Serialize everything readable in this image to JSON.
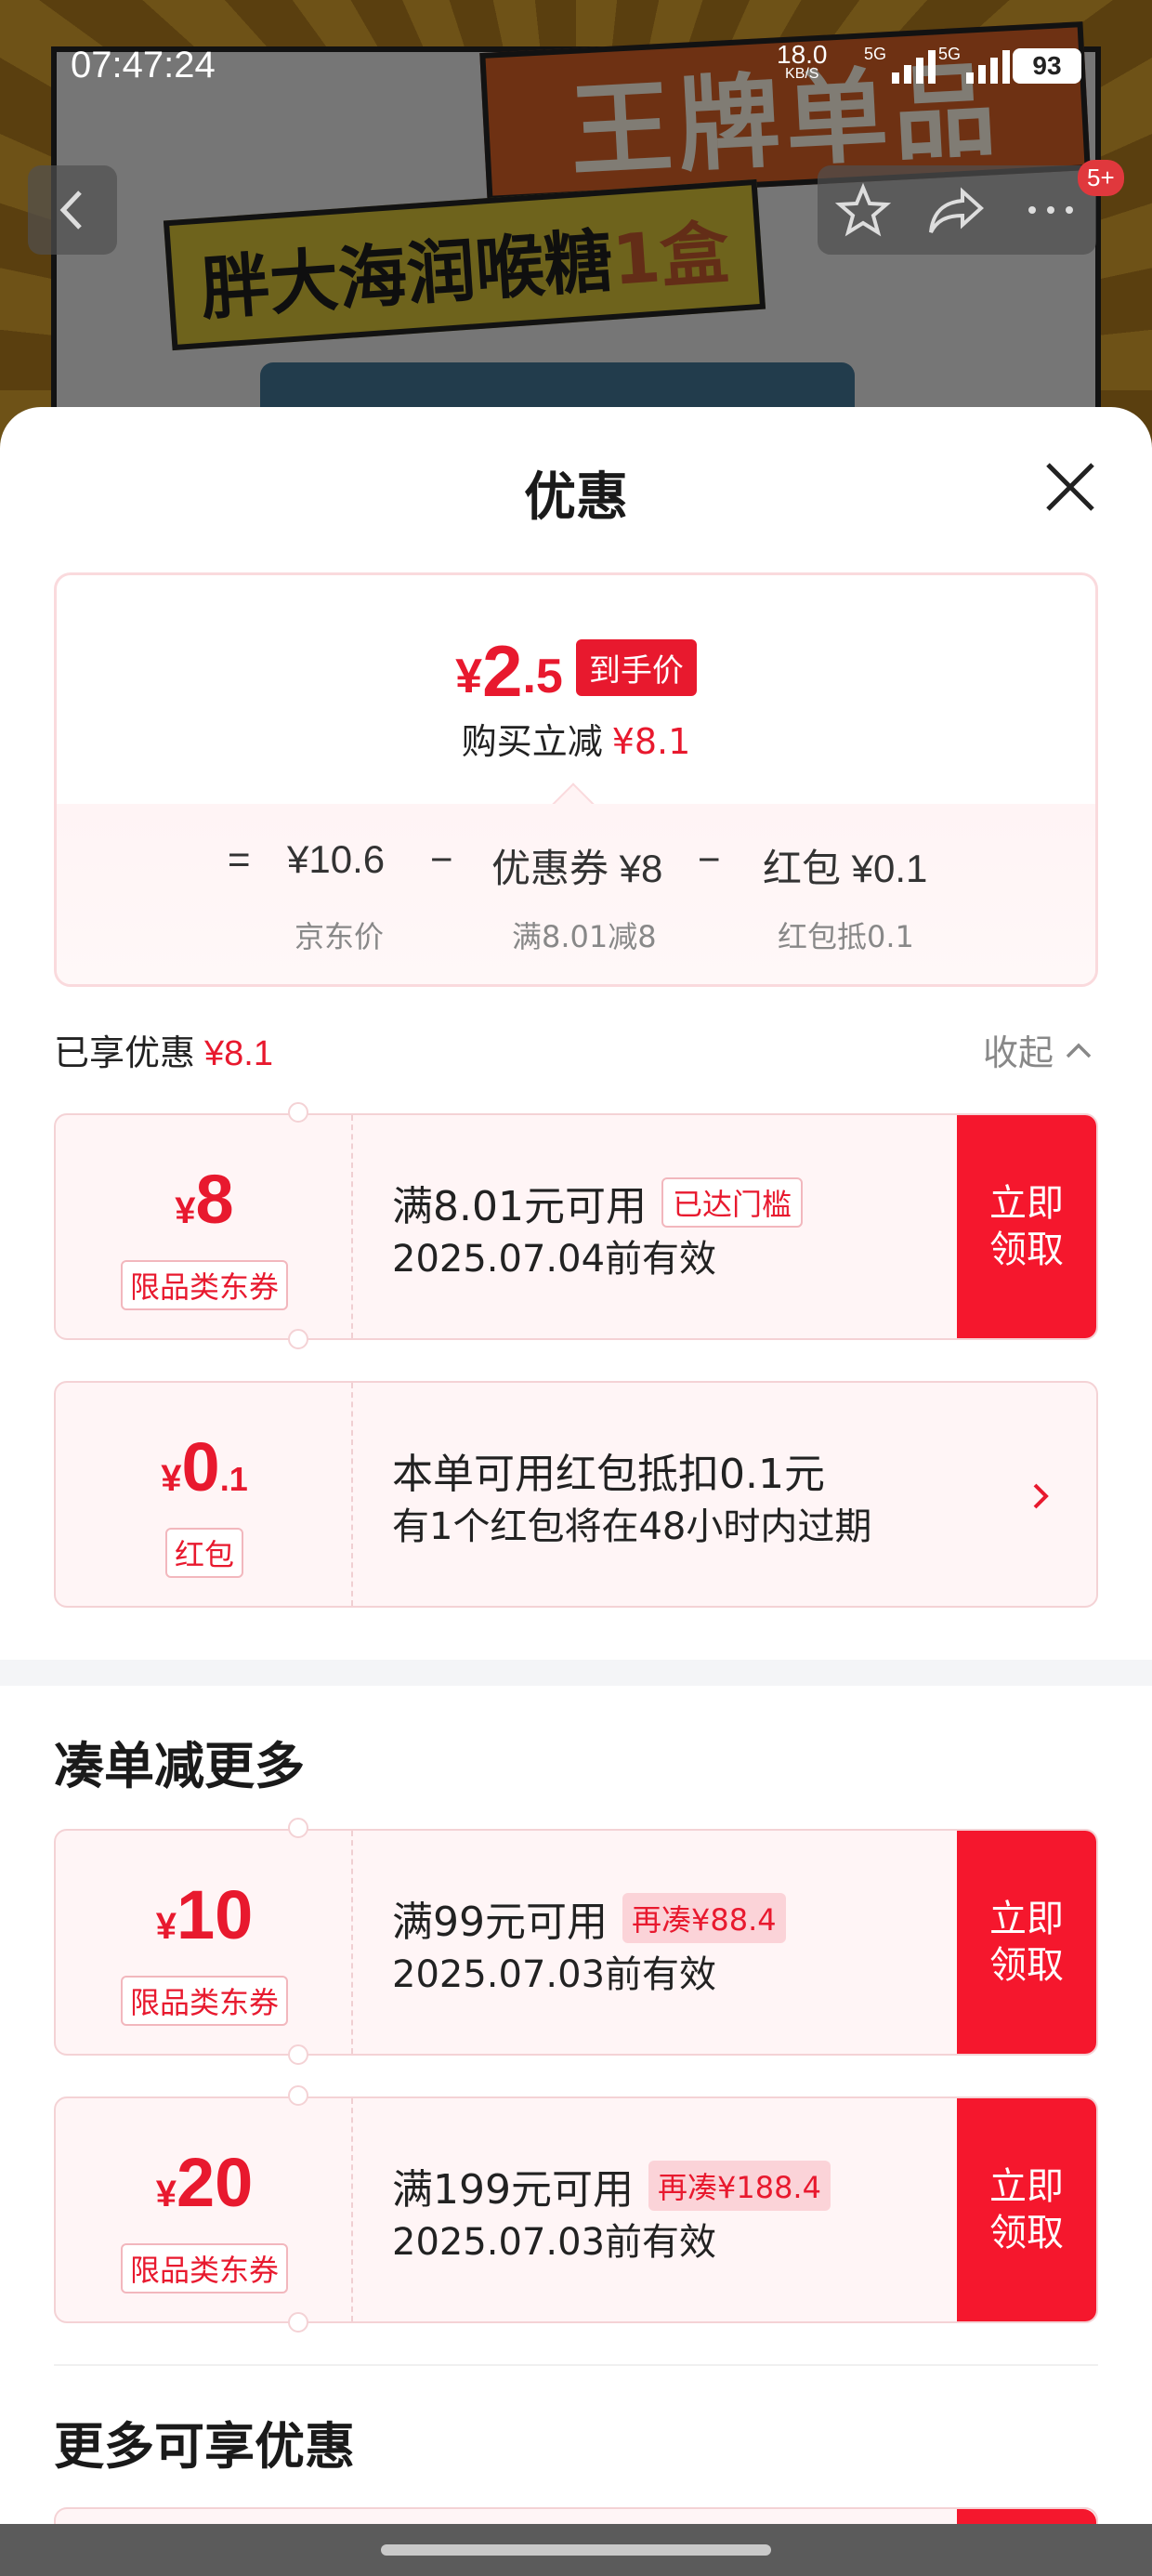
{
  "background": {
    "banner_top": "王牌单品",
    "banner_mid_text": "胖大海润喉糖",
    "banner_mid_qty": "1盒"
  },
  "status_bar": {
    "time": "07:47:24",
    "net_speed": "18.0",
    "net_unit": "KB/S",
    "sim1": "5G",
    "sim2": "5G",
    "battery": "93"
  },
  "nav": {
    "badge": "5+"
  },
  "sheet": {
    "title": "优惠",
    "summary": {
      "currency": "¥",
      "price_int": "2",
      "price_dec": ".5",
      "price_tag": "到手价",
      "save_label": "购买立减",
      "save_amount": "¥8.1",
      "eq": "=",
      "jd_price": "¥10.6",
      "minus1": "−",
      "coupon_part": "优惠券 ¥8",
      "minus2": "−",
      "redpacket_part": "红包 ¥0.1",
      "jd_price_label": "京东价",
      "coupon_part_label": "满8.01减8",
      "redpacket_part_label": "红包抵0.1"
    },
    "enjoyed": {
      "label": "已享优惠",
      "amount": "¥8.1",
      "collapse": "收起"
    },
    "coupons": [
      {
        "currency": "¥",
        "amount": "8",
        "decimal": "",
        "kind": "限品类东券",
        "line1": "满8.01元可用",
        "pill": "已达门槛",
        "line2": "2025.07.04前有效",
        "action": "立即领取"
      },
      {
        "currency": "¥",
        "amount": "0",
        "decimal": ".1",
        "kind": "红包",
        "line1": "本单可用红包抵扣0.1元",
        "pill": "",
        "line2": "有1个红包将在48小时内过期",
        "action": ""
      }
    ],
    "more_section": {
      "title": "凑单减更多",
      "coupons": [
        {
          "currency": "¥",
          "amount": "10",
          "kind": "限品类东券",
          "line1": "满99元可用",
          "pill": "再凑¥88.4",
          "line2": "2025.07.03前有效",
          "action": "立即领取"
        },
        {
          "currency": "¥",
          "amount": "20",
          "kind": "限品类东券",
          "line1": "满199元可用",
          "pill": "再凑¥188.4",
          "line2": "2025.07.03前有效",
          "action": "立即领取"
        }
      ]
    },
    "extra_section": {
      "title": "更多可享优惠"
    }
  },
  "colors": {
    "accent": "#e8192e",
    "claim_bg": "#f5172d",
    "coupon_bg": "#fff5f6"
  }
}
